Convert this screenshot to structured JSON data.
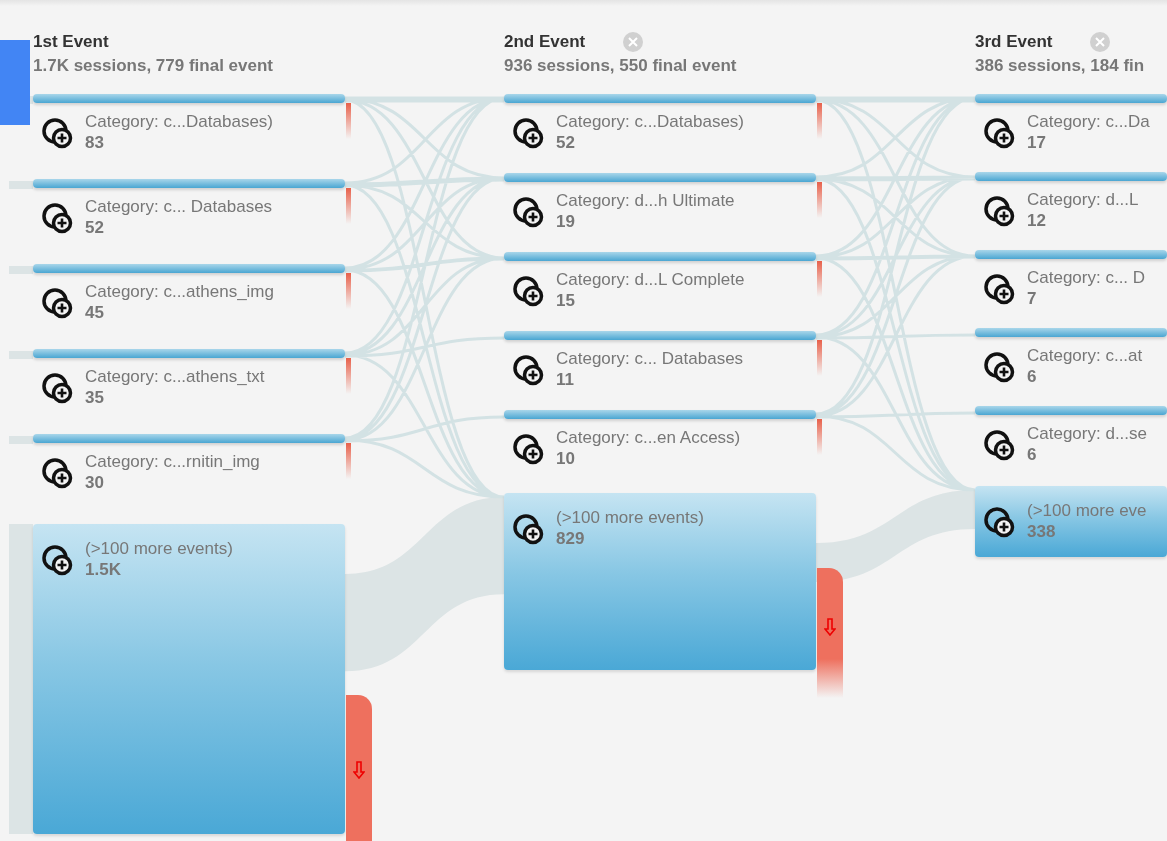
{
  "columns": [
    {
      "title": "1st Event",
      "summary": "1.7K sessions, 779 final event",
      "closable": false,
      "nodes": [
        {
          "kind": "event",
          "label": "Category: c...Databases)",
          "count": "83"
        },
        {
          "kind": "event",
          "label": "Category: c... Databases",
          "count": "52"
        },
        {
          "kind": "event",
          "label": "Category: c...athens_img",
          "count": "45"
        },
        {
          "kind": "event",
          "label": "Category: c...athens_txt",
          "count": "35"
        },
        {
          "kind": "event",
          "label": "Category: c...rnitin_img",
          "count": "30"
        },
        {
          "kind": "more",
          "label": "(>100 more events)",
          "count": "1.5K"
        }
      ]
    },
    {
      "title": "2nd Event",
      "summary": "936 sessions, 550 final event",
      "closable": true,
      "nodes": [
        {
          "kind": "event",
          "label": "Category: c...Databases)",
          "count": "52"
        },
        {
          "kind": "event",
          "label": "Category: d...h Ultimate",
          "count": "19"
        },
        {
          "kind": "event",
          "label": "Category: d...L Complete",
          "count": "15"
        },
        {
          "kind": "event",
          "label": "Category: c... Databases",
          "count": "11"
        },
        {
          "kind": "event",
          "label": "Category: c...en Access)",
          "count": "10"
        },
        {
          "kind": "more",
          "label": "(>100 more events)",
          "count": "829"
        }
      ]
    },
    {
      "title": "3rd Event",
      "summary": "386 sessions, 184 fin",
      "closable": true,
      "nodes": [
        {
          "kind": "event",
          "label": "Category: c...Da",
          "count": "17"
        },
        {
          "kind": "event",
          "label": "Category: d...L",
          "count": "12"
        },
        {
          "kind": "event",
          "label": "Category: c... D",
          "count": "7"
        },
        {
          "kind": "event",
          "label": "Category: c...at",
          "count": "6"
        },
        {
          "kind": "event",
          "label": "Category: d...se",
          "count": "6"
        },
        {
          "kind": "more",
          "label": "(>100 more eve",
          "count": "338"
        }
      ]
    }
  ]
}
